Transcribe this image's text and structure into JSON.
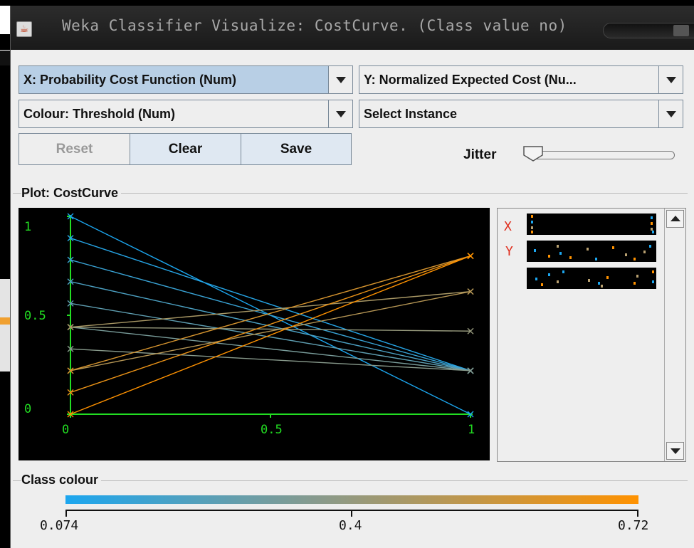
{
  "window": {
    "title": "Weka Classifier Visualize: CostCurve. (Class value no)",
    "icon": "java-cup-icon"
  },
  "controls": {
    "x_axis": "X: Probability Cost Function (Num)",
    "y_axis": "Y: Normalized Expected Cost (Nu...",
    "colour": "Colour: Threshold (Num)",
    "select_instance": "Select Instance",
    "reset": "Reset",
    "clear": "Clear",
    "save": "Save",
    "jitter": "Jitter"
  },
  "plot": {
    "title": "Plot: CostCurve",
    "x_ticks": [
      "0",
      "0.5",
      "1"
    ],
    "y_ticks": [
      "1",
      "0.5",
      "0"
    ]
  },
  "side": {
    "x_label": "X",
    "y_label": "Y"
  },
  "class_colour": {
    "title": "Class colour",
    "min": "0.074",
    "mid": "0.4",
    "max": "0.72",
    "colors": [
      "#1ca6ef",
      "#ff9200"
    ]
  },
  "chart_data": {
    "type": "line",
    "xlim": [
      0,
      1
    ],
    "ylim": [
      0,
      1
    ],
    "x_ticks": [
      0,
      0.5,
      1
    ],
    "y_ticks": [
      0,
      0.5,
      1
    ],
    "grid": false,
    "series": [
      {
        "x": [
          0,
          1
        ],
        "y": [
          1.0,
          0.0
        ],
        "threshold": 0.074
      },
      {
        "x": [
          0,
          1
        ],
        "y": [
          0.89,
          0.22
        ],
        "threshold": 0.1
      },
      {
        "x": [
          0,
          1
        ],
        "y": [
          0.78,
          0.22
        ],
        "threshold": 0.15
      },
      {
        "x": [
          0,
          1
        ],
        "y": [
          0.67,
          0.22
        ],
        "threshold": 0.2
      },
      {
        "x": [
          0,
          1
        ],
        "y": [
          0.56,
          0.22
        ],
        "threshold": 0.25
      },
      {
        "x": [
          0,
          1
        ],
        "y": [
          0.44,
          0.22
        ],
        "threshold": 0.32
      },
      {
        "x": [
          0,
          1
        ],
        "y": [
          0.44,
          0.42
        ],
        "threshold": 0.4
      },
      {
        "x": [
          0,
          1
        ],
        "y": [
          0.33,
          0.22
        ],
        "threshold": 0.36
      },
      {
        "x": [
          0,
          1
        ],
        "y": [
          0.44,
          0.62
        ],
        "threshold": 0.46
      },
      {
        "x": [
          0,
          1
        ],
        "y": [
          0.22,
          0.62
        ],
        "threshold": 0.5
      },
      {
        "x": [
          0,
          1
        ],
        "y": [
          0.22,
          0.8
        ],
        "threshold": 0.6
      },
      {
        "x": [
          0,
          1
        ],
        "y": [
          0.11,
          0.8
        ],
        "threshold": 0.66
      },
      {
        "x": [
          0,
          1
        ],
        "y": [
          0.0,
          0.8
        ],
        "threshold": 0.72
      }
    ]
  }
}
